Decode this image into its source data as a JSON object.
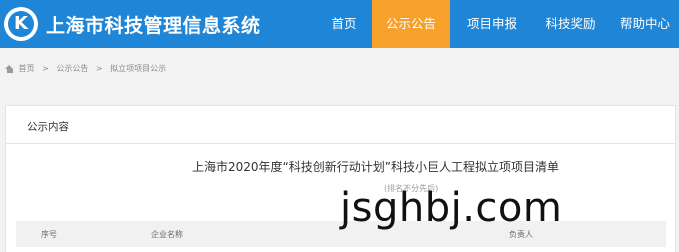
{
  "header": {
    "logo_letter": "K",
    "site_title": "上海市科技管理信息系统",
    "brand_color": "#1f85d6",
    "active_color": "#f7a02a"
  },
  "nav": {
    "items": [
      {
        "label": "首页"
      },
      {
        "label": "公示公告",
        "active": true
      },
      {
        "label": "项目申报"
      },
      {
        "label": "科技奖励"
      },
      {
        "label": "帮助中心"
      }
    ]
  },
  "breadcrumb": {
    "icon": "home-icon",
    "items": [
      "首页",
      "公示公告",
      "拟立项项目公示"
    ],
    "separator": ">"
  },
  "panel": {
    "title": "公示内容"
  },
  "document": {
    "title": "上海市2020年度“科技创新行动计划”科技小巨人工程拟立项项目清单",
    "note": "(排名不分先后)"
  },
  "table": {
    "headers": [
      "序号",
      "企业名称",
      "负责人"
    ]
  },
  "watermark": {
    "text": "jsghbj.com"
  }
}
